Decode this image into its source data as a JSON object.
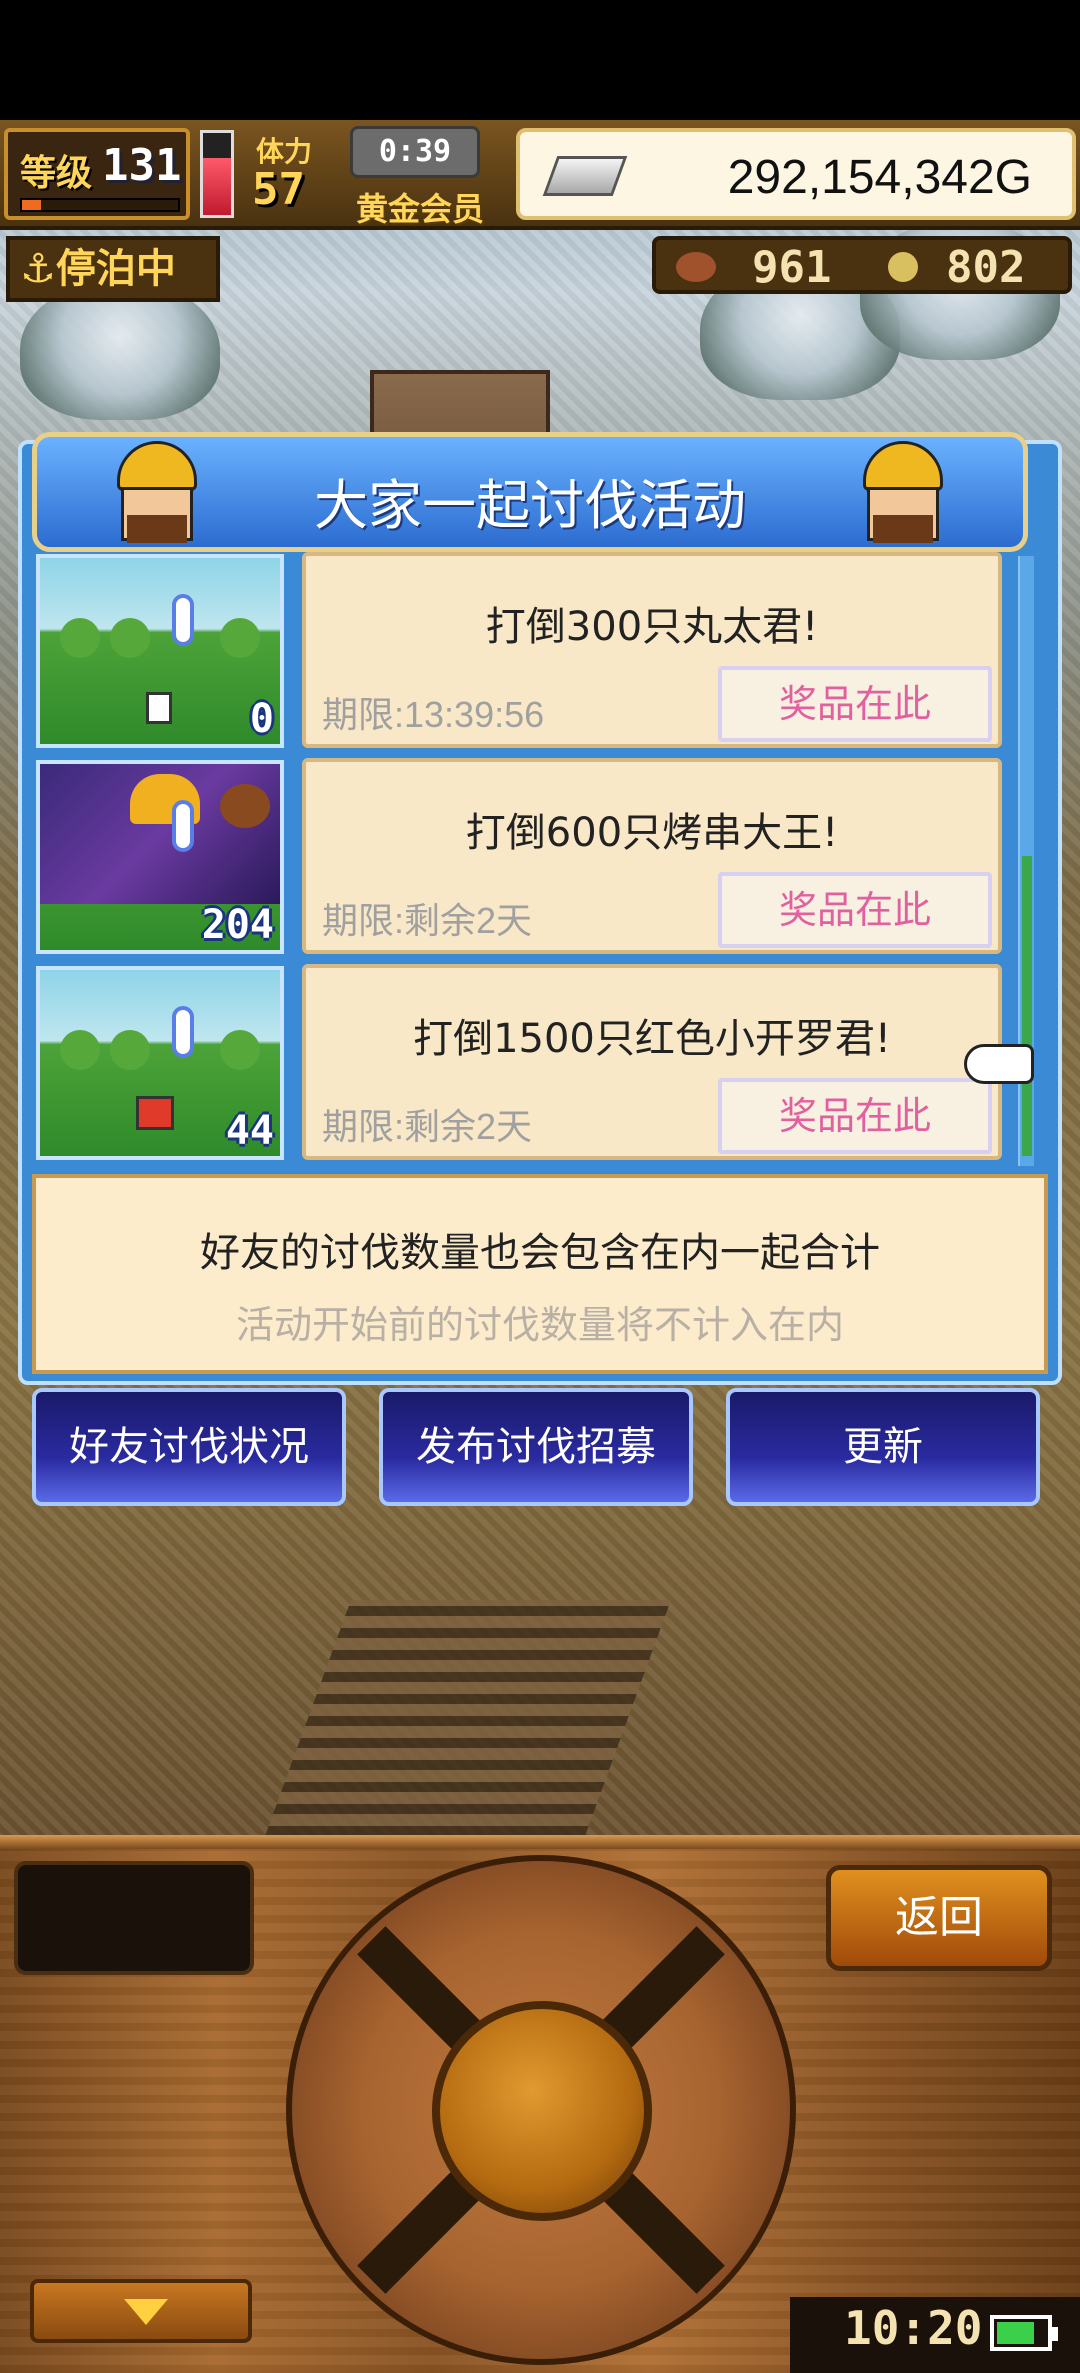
{
  "hud": {
    "level_label": "等级",
    "level": "131",
    "xp_fraction": 0.12,
    "hp_fraction": 0.7,
    "stamina_label": "体力",
    "stamina": "57",
    "timer": "0:39",
    "membership": "黄金会员",
    "gold": "292,154,342G",
    "status": "停泊中",
    "resource1": "961",
    "resource2": "802"
  },
  "dialog": {
    "title": "大家一起讨伐活动",
    "quests": [
      {
        "title": "打倒300只丸太君!",
        "limit": "期限:13:39:56",
        "prize": "奖品在此",
        "count": "0"
      },
      {
        "title": "打倒600只烤串大王!",
        "limit": "期限:剩余2天",
        "prize": "奖品在此",
        "count": "204"
      },
      {
        "title": "打倒1500只红色小开罗君!",
        "limit": "期限:剩余2天",
        "prize": "奖品在此",
        "count": "44"
      }
    ],
    "info_main": "好友的讨伐数量也会包含在内一起合计",
    "info_sub": "活动开始前的讨伐数量将不计入在内",
    "buttons": {
      "friends": "好友讨伐状况",
      "recruit": "发布讨伐招募",
      "refresh": "更新"
    }
  },
  "control": {
    "back": "返回",
    "clock": "10:20",
    "battery_fraction": 0.8
  },
  "colors": {
    "dialog_blue": "#3a8ad6",
    "prize_text": "#e060a0",
    "button_blue": "#2a2aa0"
  },
  "icons": [
    "anchor-icon",
    "silver-bar-icon",
    "hand-cursor-icon",
    "down-arrow-icon",
    "battery-icon"
  ]
}
